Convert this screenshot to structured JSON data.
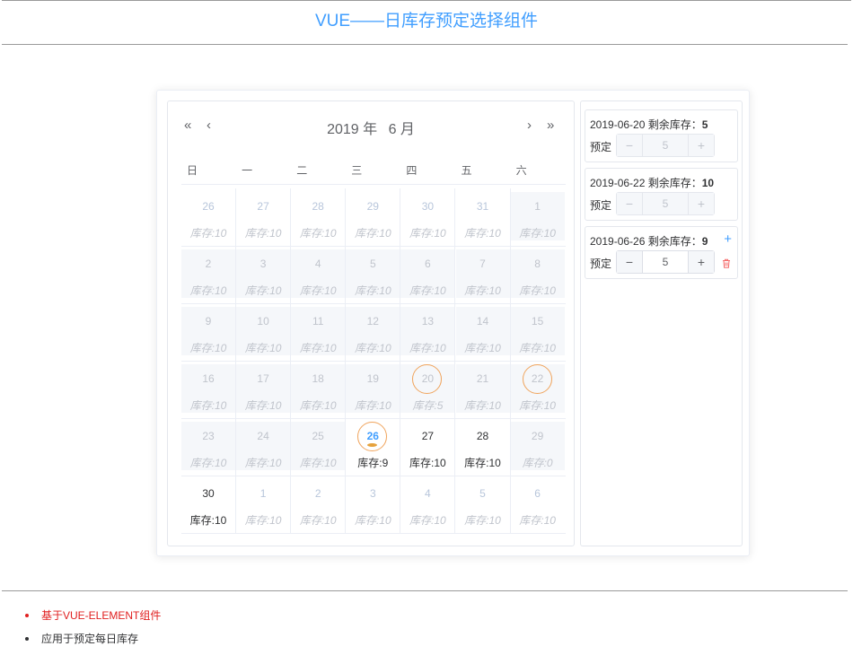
{
  "page": {
    "title": "VUE——日库存预定选择组件"
  },
  "calendar": {
    "year": "2019 年",
    "month": "6 月",
    "nav": {
      "prev_year": "«",
      "prev_month": "‹",
      "next_month": "›",
      "next_year": "»"
    },
    "weekdays": [
      "日",
      "一",
      "二",
      "三",
      "四",
      "五",
      "六"
    ],
    "stock_prefix": "库存:",
    "rows": [
      [
        {
          "d": "26",
          "s": "10",
          "st": "out"
        },
        {
          "d": "27",
          "s": "10",
          "st": "out"
        },
        {
          "d": "28",
          "s": "10",
          "st": "out"
        },
        {
          "d": "29",
          "s": "10",
          "st": "out"
        },
        {
          "d": "30",
          "s": "10",
          "st": "out"
        },
        {
          "d": "31",
          "s": "10",
          "st": "out"
        },
        {
          "d": "1",
          "s": "10",
          "st": "dis"
        }
      ],
      [
        {
          "d": "2",
          "s": "10",
          "st": "dis"
        },
        {
          "d": "3",
          "s": "10",
          "st": "dis"
        },
        {
          "d": "4",
          "s": "10",
          "st": "dis"
        },
        {
          "d": "5",
          "s": "10",
          "st": "dis"
        },
        {
          "d": "6",
          "s": "10",
          "st": "dis"
        },
        {
          "d": "7",
          "s": "10",
          "st": "dis"
        },
        {
          "d": "8",
          "s": "10",
          "st": "dis"
        }
      ],
      [
        {
          "d": "9",
          "s": "10",
          "st": "dis"
        },
        {
          "d": "10",
          "s": "10",
          "st": "dis"
        },
        {
          "d": "11",
          "s": "10",
          "st": "dis"
        },
        {
          "d": "12",
          "s": "10",
          "st": "dis"
        },
        {
          "d": "13",
          "s": "10",
          "st": "dis"
        },
        {
          "d": "14",
          "s": "10",
          "st": "dis"
        },
        {
          "d": "15",
          "s": "10",
          "st": "dis"
        }
      ],
      [
        {
          "d": "16",
          "s": "10",
          "st": "dis"
        },
        {
          "d": "17",
          "s": "10",
          "st": "dis"
        },
        {
          "d": "18",
          "s": "10",
          "st": "dis"
        },
        {
          "d": "19",
          "s": "10",
          "st": "dis"
        },
        {
          "d": "20",
          "s": "5",
          "st": "dis",
          "ring": true
        },
        {
          "d": "21",
          "s": "10",
          "st": "dis"
        },
        {
          "d": "22",
          "s": "10",
          "st": "dis",
          "ring": true
        }
      ],
      [
        {
          "d": "23",
          "s": "10",
          "st": "dis"
        },
        {
          "d": "24",
          "s": "10",
          "st": "dis"
        },
        {
          "d": "25",
          "s": "10",
          "st": "dis"
        },
        {
          "d": "26",
          "s": "9",
          "st": "today",
          "ring": true,
          "dot": true
        },
        {
          "d": "27",
          "s": "10",
          "st": "ok"
        },
        {
          "d": "28",
          "s": "10",
          "st": "ok"
        },
        {
          "d": "29",
          "s": "0",
          "st": "dis"
        }
      ],
      [
        {
          "d": "30",
          "s": "10",
          "st": "ok"
        },
        {
          "d": "1",
          "s": "10",
          "st": "out"
        },
        {
          "d": "2",
          "s": "10",
          "st": "out"
        },
        {
          "d": "3",
          "s": "10",
          "st": "out"
        },
        {
          "d": "4",
          "s": "10",
          "st": "out"
        },
        {
          "d": "5",
          "s": "10",
          "st": "out"
        },
        {
          "d": "6",
          "s": "10",
          "st": "out"
        }
      ]
    ]
  },
  "bookings": [
    {
      "date": "2019-06-20",
      "label": "剩余库存：",
      "remain": "5",
      "book_label": "预定",
      "qty": "5",
      "disabled": true,
      "minus": "−",
      "plus": "+"
    },
    {
      "date": "2019-06-22",
      "label": "剩余库存：",
      "remain": "10",
      "book_label": "预定",
      "qty": "5",
      "disabled": true,
      "minus": "−",
      "plus": "+"
    },
    {
      "date": "2019-06-26",
      "label": "剩余库存：",
      "remain": "9",
      "book_label": "预定",
      "qty": "5",
      "disabled": false,
      "minus": "−",
      "plus": "+",
      "add_icon": "plus-icon",
      "del_icon": "trash-icon"
    }
  ],
  "notes": [
    {
      "text": "基于VUE-ELEMENT组件",
      "color": "#e02020"
    },
    {
      "text": "应用于预定每日库存",
      "color": "#303133"
    }
  ],
  "colors": {
    "accent": "#409eff",
    "ring": "#f0a45c",
    "danger": "#f56c6c"
  }
}
